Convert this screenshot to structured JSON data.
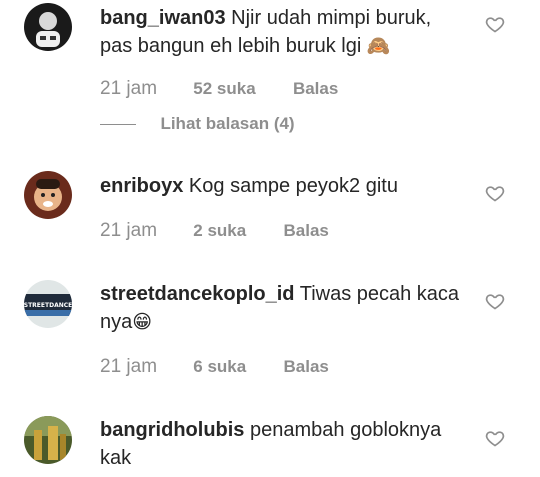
{
  "comments": [
    {
      "username": "bang_iwan03",
      "text": "Njir udah mimpi buruk, pas bangun eh lebih buruk lgi",
      "emoji": "🙈",
      "time": "21 jam",
      "likes": "52 suka",
      "reply": "Balas",
      "view_replies": "Lihat balasan (4)"
    },
    {
      "username": "enriboyx",
      "text": "Kog sampe peyok2 gitu",
      "emoji": "",
      "time": "21 jam",
      "likes": "2 suka",
      "reply": "Balas"
    },
    {
      "username": "streetdancekoplo_id",
      "text": "Tiwas pecah kaca nya",
      "emoji": "😁",
      "time": "21 jam",
      "likes": "6 suka",
      "reply": "Balas"
    },
    {
      "username": "bangridholubis",
      "text": "penambah gobloknya kak",
      "emoji": ""
    }
  ],
  "colors": {
    "primary_text": "#262626",
    "secondary_text": "#8e8e8e",
    "background": "#ffffff"
  },
  "icons": [
    "heart-icon"
  ],
  "avatar_text": {
    "streetdancekoplo_id": "STREETDANCE"
  }
}
